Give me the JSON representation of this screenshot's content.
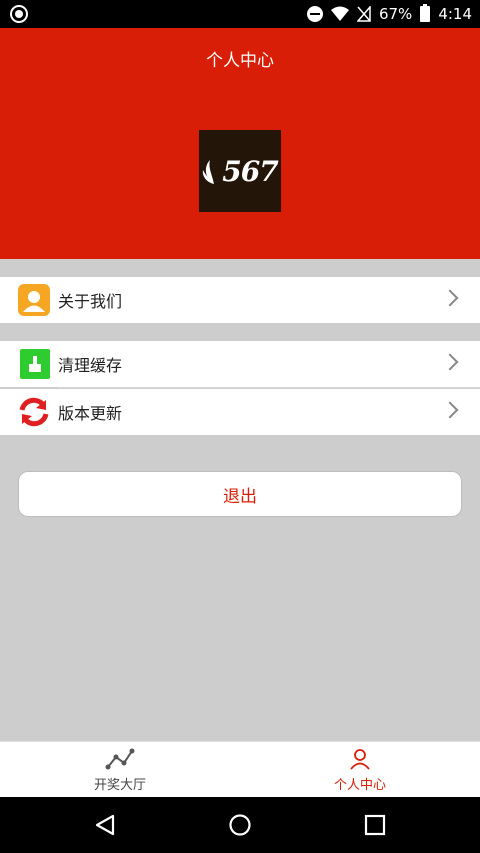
{
  "status_bar": {
    "battery": "67%",
    "time": "4:14"
  },
  "header": {
    "title": "个人中心",
    "logo_text": "567"
  },
  "menu": {
    "items": [
      {
        "label": "关于我们",
        "icon": "user-card-icon",
        "color": "#f5a623"
      },
      {
        "label": "清理缓存",
        "icon": "broom-icon",
        "color": "#2ecc2e"
      },
      {
        "label": "版本更新",
        "icon": "refresh-icon",
        "color": "#e02020"
      }
    ]
  },
  "logout": {
    "label": "退出"
  },
  "bottom_nav": {
    "items": [
      {
        "label": "开奖大厅",
        "icon": "trend-icon"
      },
      {
        "label": "个人中心",
        "icon": "person-icon",
        "active": true
      }
    ]
  },
  "colors": {
    "brand": "#d81e06",
    "background": "#cdcdcd"
  }
}
